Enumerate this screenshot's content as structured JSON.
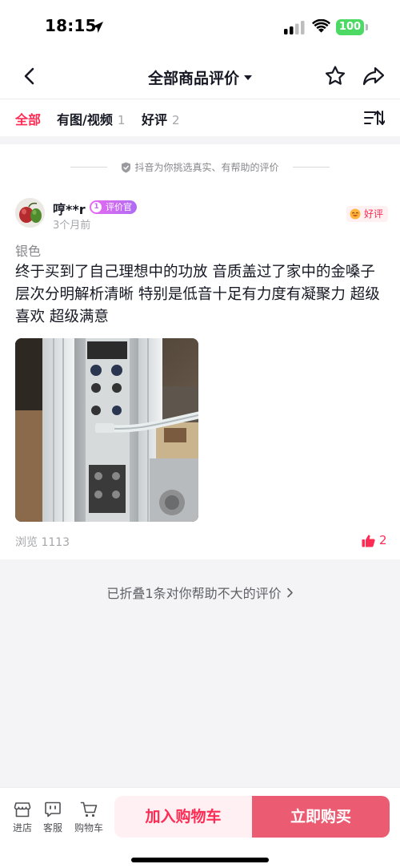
{
  "status_bar": {
    "time": "18:15",
    "battery": "100"
  },
  "nav": {
    "title": "全部商品评价"
  },
  "filters": {
    "tabs": [
      {
        "label": "全部",
        "count": ""
      },
      {
        "label": "有图/视频",
        "count": "1"
      },
      {
        "label": "好评",
        "count": "2"
      }
    ]
  },
  "notice": "抖音为你挑选真实、有帮助的评价",
  "review": {
    "user_name": "哼**r",
    "badge_level": "1",
    "badge_label": "评价官",
    "time": "3个月前",
    "rating_label": "好评",
    "sku": "银色",
    "text": "终于买到了自己理想中的功放 音质盖过了家中的金嗓子 层次分明解析清晰 特别是低音十足有力度有凝聚力 超级喜欢 超级满意",
    "views": "浏览 1113",
    "likes": "2"
  },
  "folded": "已折叠1条对你帮助不大的评价",
  "bottom_bar": {
    "store_label": "进店",
    "service_label": "客服",
    "cart_label": "购物车",
    "add_cart_label": "加入购物车",
    "buy_label": "立即购买"
  },
  "colors": {
    "accent": "#fe2c55",
    "buy_button": "#eb5b72",
    "battery": "#4cd964"
  }
}
